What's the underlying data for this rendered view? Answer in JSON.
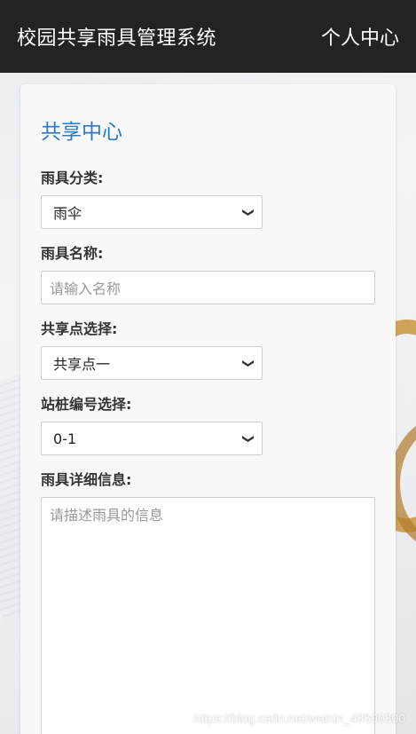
{
  "header": {
    "brand": "校园共享雨具管理系统",
    "user_center": "个人中心"
  },
  "card": {
    "title": "共享中心"
  },
  "form": {
    "category": {
      "label": "雨具分类:",
      "value": "雨伞"
    },
    "name": {
      "label": "雨具名称:",
      "placeholder": "请输入名称"
    },
    "share_point": {
      "label": "共享点选择:",
      "value": "共享点一"
    },
    "station_no": {
      "label": "站桩编号选择:",
      "value": "0-1"
    },
    "detail": {
      "label": "雨具详细信息:",
      "placeholder": "请描述雨具的信息"
    }
  },
  "watermark": "https://blog.csdn.net/weixin_48500300",
  "colors": {
    "topbar": "#232323",
    "title": "#2a7bc4",
    "card": "#f8f8f8"
  }
}
